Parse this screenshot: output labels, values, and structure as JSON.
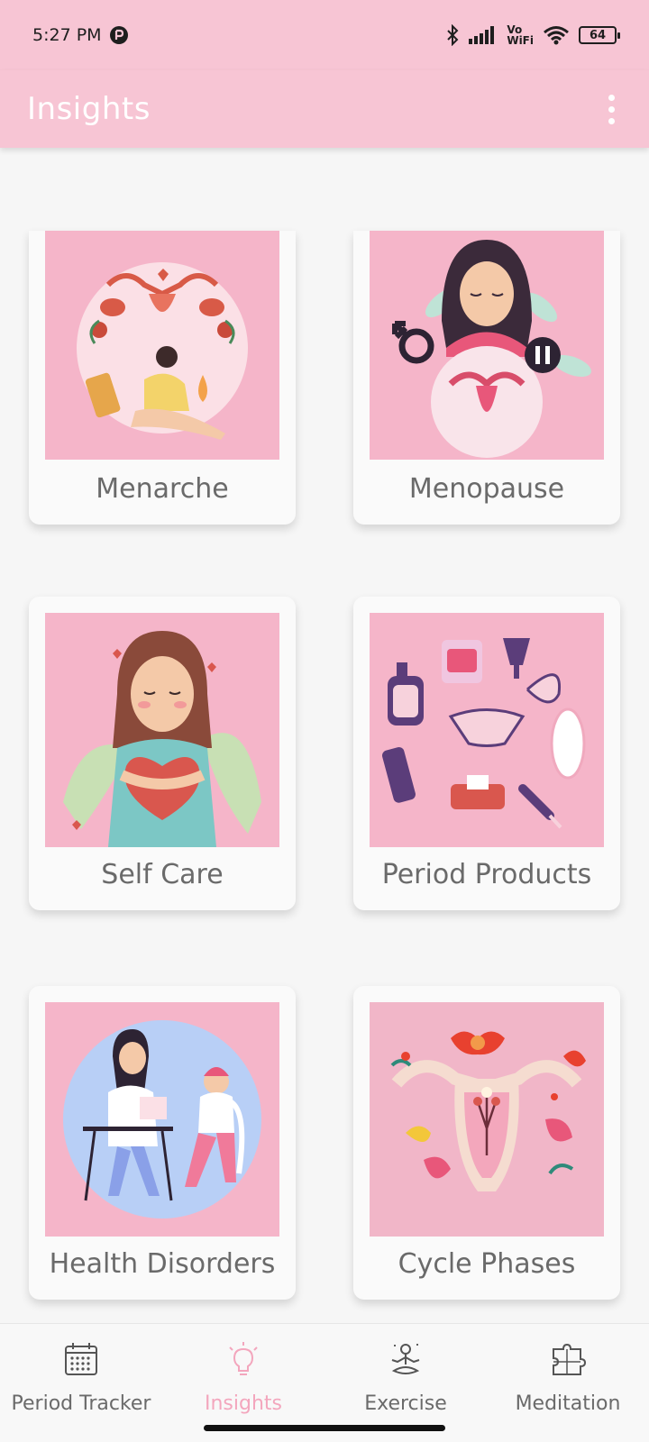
{
  "status_bar": {
    "time": "5:27 PM",
    "network_label_top": "Vo",
    "network_label_bottom": "WiFi",
    "battery": "64"
  },
  "app_bar": {
    "title": "Insights"
  },
  "cards": [
    {
      "label": "Menarche"
    },
    {
      "label": "Menopause"
    },
    {
      "label": "Self Care"
    },
    {
      "label": "Period Products"
    },
    {
      "label": "Health Disorders"
    },
    {
      "label": "Cycle Phases"
    }
  ],
  "bottom_nav": {
    "items": [
      {
        "label": "Period Tracker",
        "icon": "calendar-icon"
      },
      {
        "label": "Insights",
        "icon": "lightbulb-icon",
        "active": true
      },
      {
        "label": "Exercise",
        "icon": "meditating-person-icon"
      },
      {
        "label": "Meditation",
        "icon": "puzzle-icon"
      }
    ]
  },
  "colors": {
    "app_bar": "#f7c5d4",
    "card_art_bg": "#f5b5c9",
    "active_nav": "#f3a6bd",
    "inactive_text": "#6a6a6a"
  }
}
